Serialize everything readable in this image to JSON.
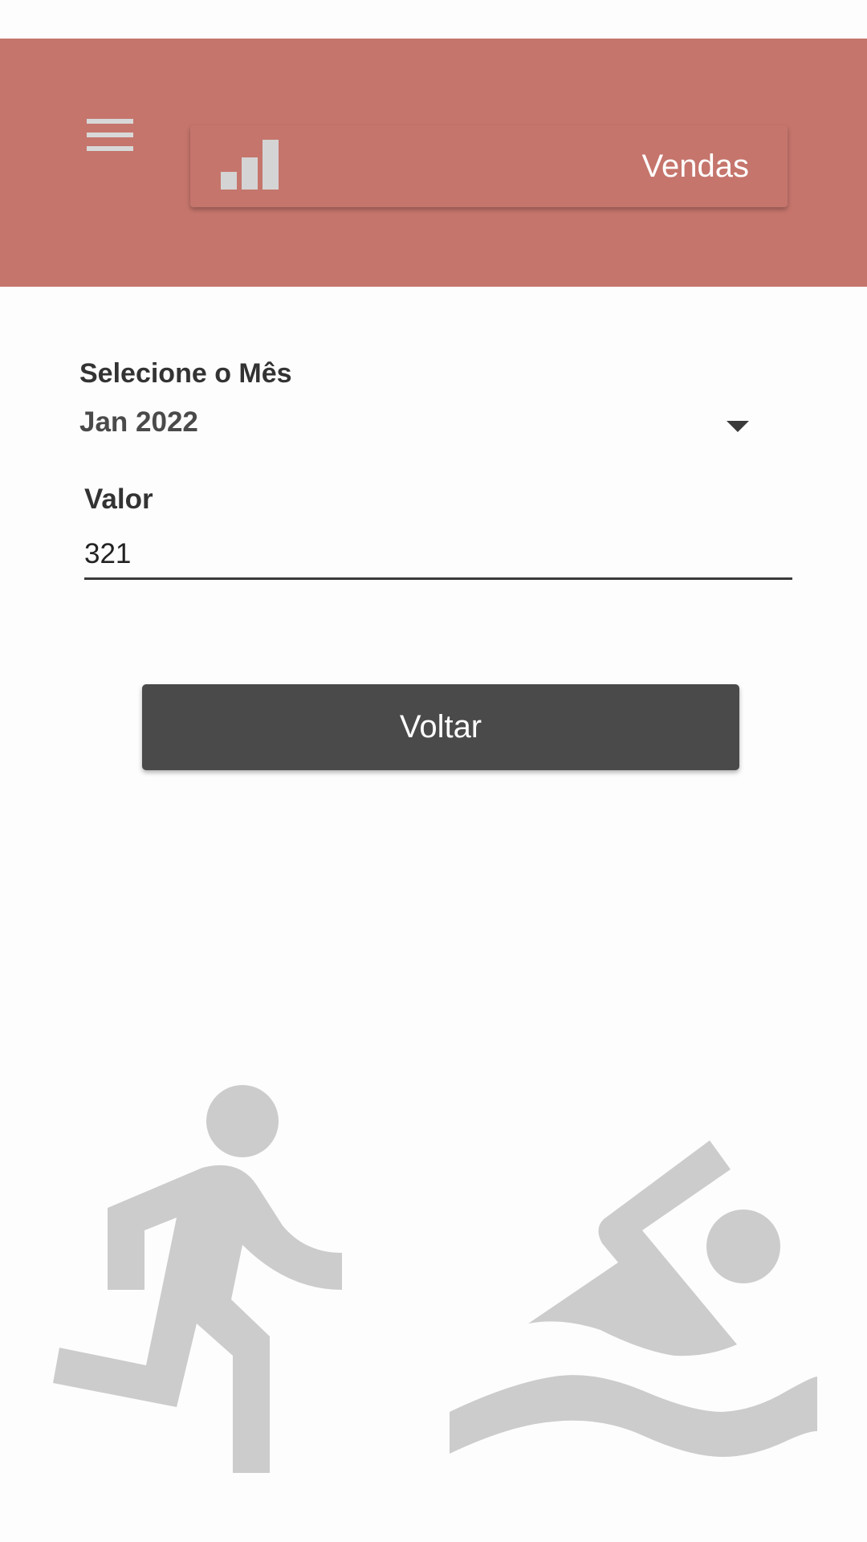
{
  "header": {
    "title": "Vendas",
    "background_color": "#c5756c",
    "menu_icon": "menu-icon",
    "chart_icon": "bar-chart-icon"
  },
  "form": {
    "month_label": "Selecione o Mês",
    "month_value": "Jan 2022",
    "valor_label": "Valor",
    "valor_value": "321"
  },
  "actions": {
    "back_label": "Voltar",
    "back_color": "#4a4a4a"
  },
  "illustrations": {
    "left": "running-person-icon",
    "right": "swimming-person-icon",
    "color": "#cccccc"
  }
}
